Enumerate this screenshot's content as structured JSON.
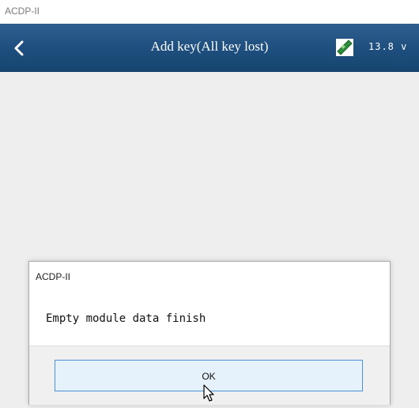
{
  "window": {
    "title": "ACDP-II"
  },
  "appbar": {
    "back_icon": "chevron-left-icon",
    "title": "Add key(All key lost)",
    "battery_icon": "battery-icon",
    "voltage": "13.8 v"
  },
  "dialog": {
    "title": "ACDP-II",
    "message": "Empty module data finish",
    "ok_label": "OK"
  },
  "colors": {
    "appbar": "#1e4f7f",
    "button_border": "#4a90d9",
    "button_fill": "#e5f1fb"
  }
}
